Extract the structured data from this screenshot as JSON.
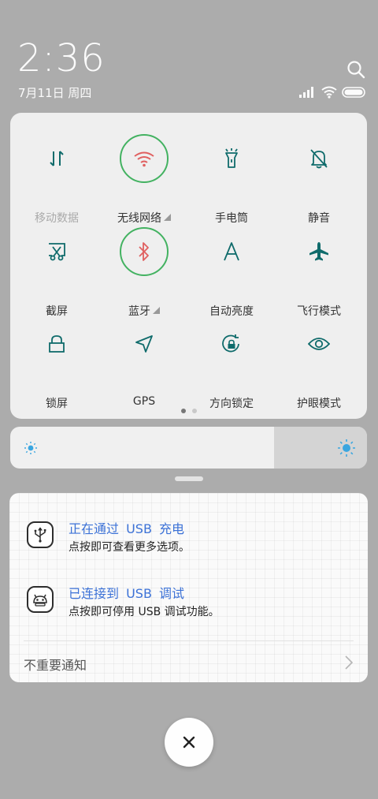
{
  "status": {
    "time": "2:36",
    "date": "7月11日 周四"
  },
  "quick_settings": {
    "tiles": [
      {
        "label": "移动数据",
        "icon": "mobile-data-icon",
        "active": false,
        "dim": true
      },
      {
        "label": "无线网络",
        "icon": "wifi-icon",
        "active": true,
        "expandable": true
      },
      {
        "label": "手电筒",
        "icon": "flashlight-icon",
        "active": false
      },
      {
        "label": "静音",
        "icon": "mute-bell-icon",
        "active": false
      },
      {
        "label": "截屏",
        "icon": "screenshot-icon",
        "active": false
      },
      {
        "label": "蓝牙",
        "icon": "bluetooth-icon",
        "active": true,
        "expandable": true
      },
      {
        "label": "自动亮度",
        "icon": "auto-brightness-icon",
        "active": false
      },
      {
        "label": "飞行模式",
        "icon": "airplane-icon",
        "active": false
      },
      {
        "label": "锁屏",
        "icon": "lock-icon",
        "active": false
      },
      {
        "label": "GPS",
        "icon": "gps-icon",
        "active": false
      },
      {
        "label": "方向锁定",
        "icon": "rotation-lock-icon",
        "active": false
      },
      {
        "label": "护眼模式",
        "icon": "eye-icon",
        "active": false
      }
    ],
    "page_index": 1,
    "page_count": 2
  },
  "brightness": {
    "level": 0.74
  },
  "notifications": {
    "items": [
      {
        "title": "正在通过 USB 充电",
        "text": "点按即可查看更多选项。",
        "icon": "usb-icon"
      },
      {
        "title": "已连接到 USB 调试",
        "text": "点按即可停用 USB 调试功能。",
        "icon": "android-debug-icon"
      }
    ],
    "footer": "不重要通知"
  },
  "colors": {
    "icon_teal": "#0f6b6b",
    "active_red": "#e06060",
    "active_ring": "#43b261",
    "accent_blue": "#3c72d7",
    "sun_blue": "#3aa6e0"
  }
}
